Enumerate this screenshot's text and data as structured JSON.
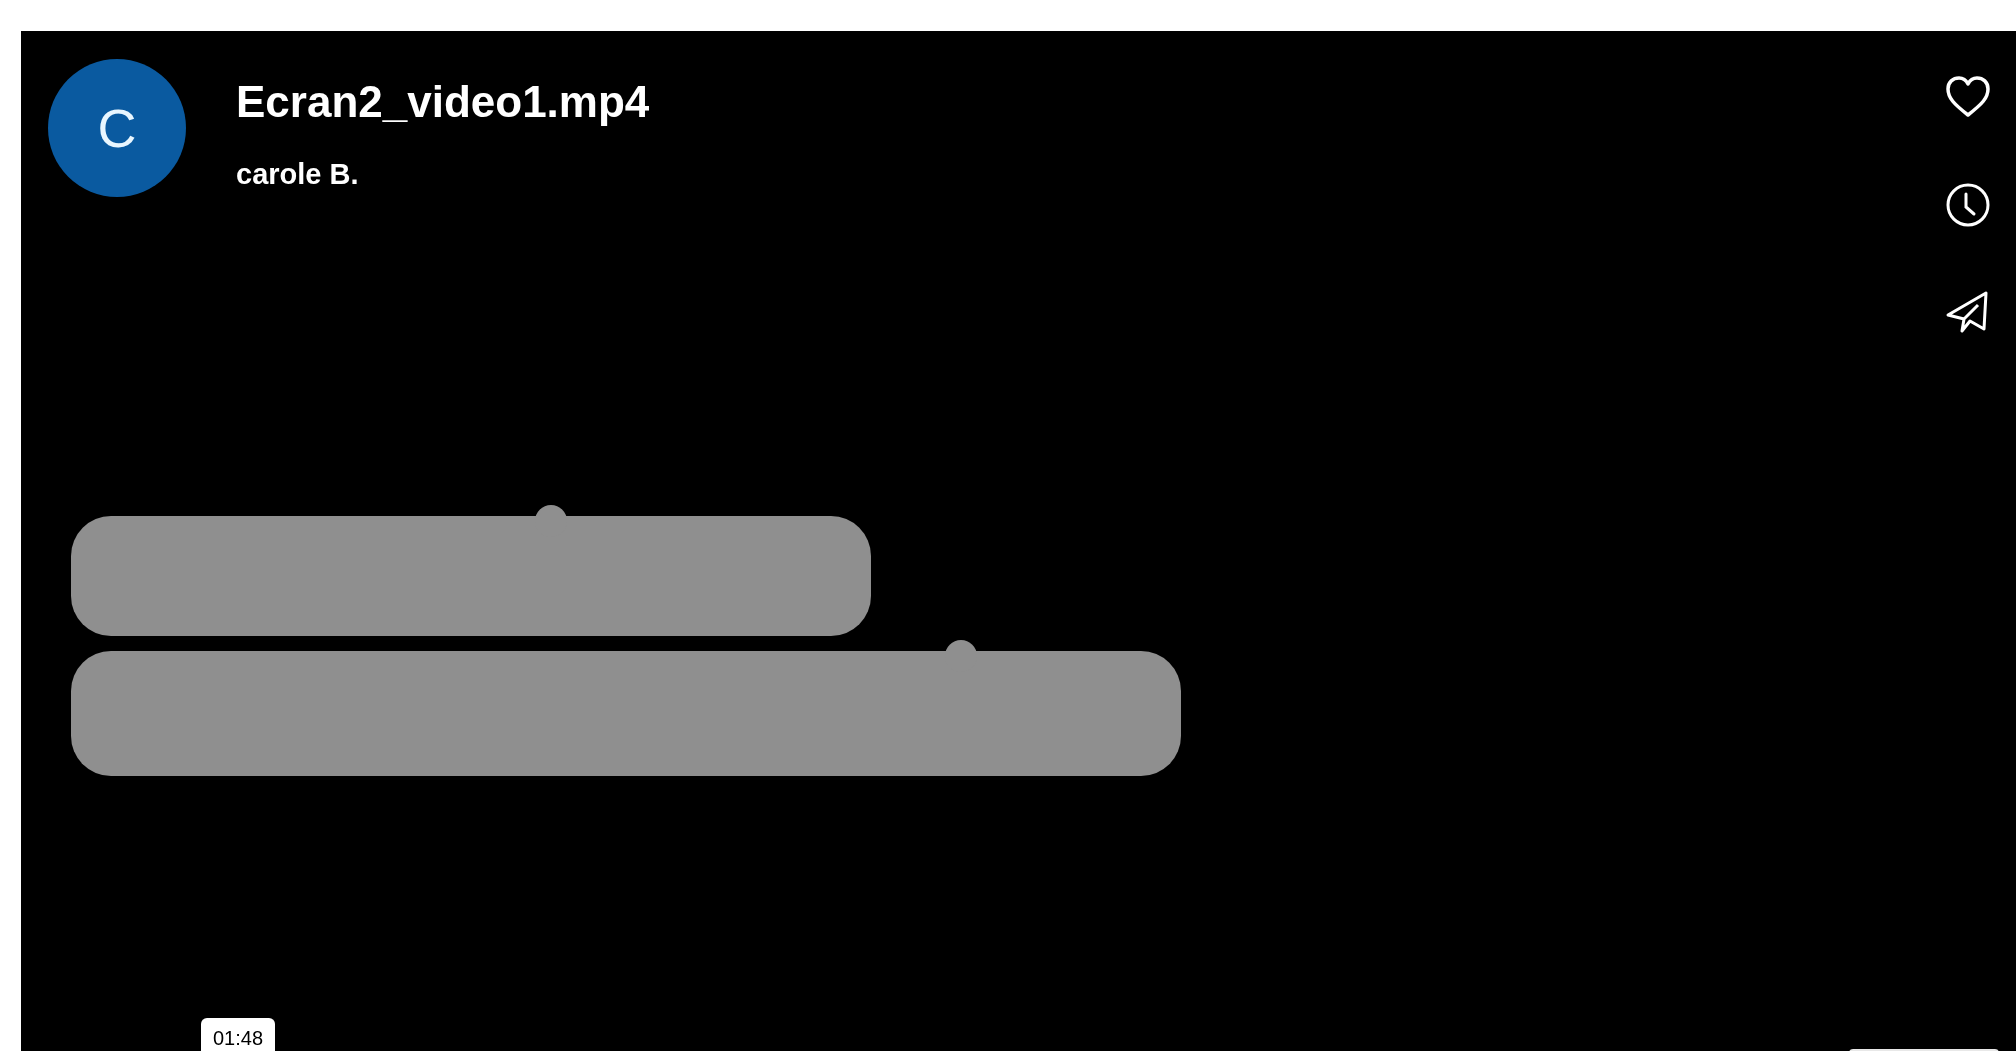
{
  "header": {
    "avatar_letter": "C",
    "title": "Ecran2_video1.mp4",
    "author": "carole B."
  },
  "actions": [
    {
      "kind": "like"
    },
    {
      "kind": "watch_later"
    },
    {
      "kind": "share"
    }
  ],
  "duration": "01:48"
}
